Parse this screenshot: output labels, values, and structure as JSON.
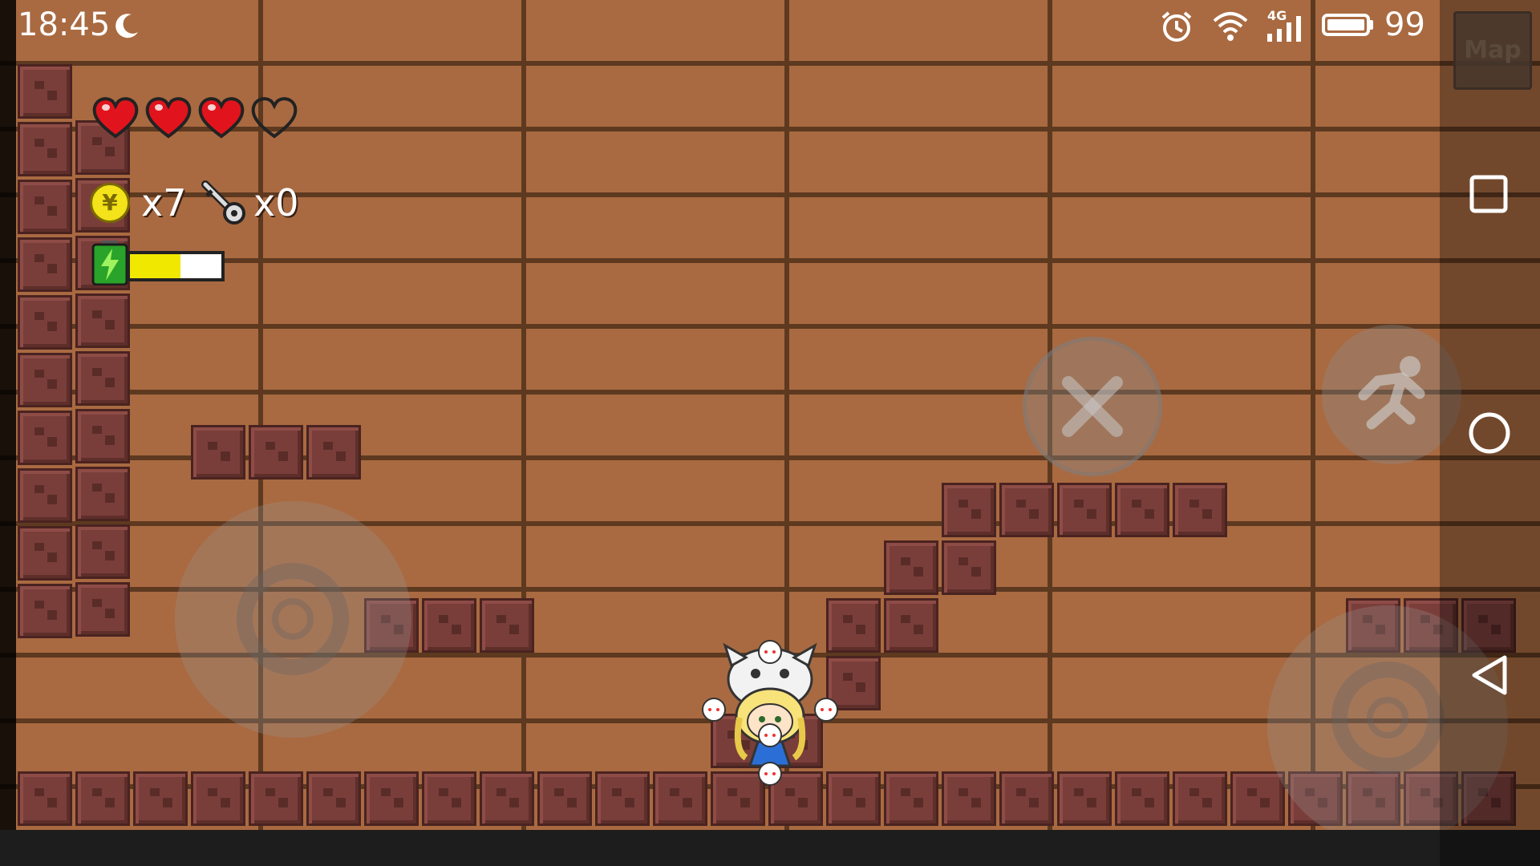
{
  "status_bar": {
    "time": "18:45",
    "moon_icon": "moon-icon",
    "alarm_icon": "alarm-icon",
    "wifi_icon": "wifi-icon",
    "network_label": "4G",
    "battery_level": "99"
  },
  "map_button": {
    "label": "Map"
  },
  "hud": {
    "hearts_filled": 3,
    "hearts_total": 4,
    "coin_symbol": "¥",
    "coins": "x7",
    "keys": "x0",
    "energy_fraction": 0.55
  },
  "controls": {
    "left_joystick": "move-joystick",
    "right_joystick": "aim-joystick",
    "cancel_button": "close-icon",
    "dash_button": "running-man-icon"
  },
  "nav_bar": {
    "recent": "square-icon",
    "home": "circle-icon",
    "back": "triangle-back-icon"
  },
  "colors": {
    "wall": "#a96a41",
    "plank_line": "#5d3920",
    "block": "#7a3e3a",
    "heart": "#e1141d",
    "coin": "#f4e21a",
    "energy": "#f1e800"
  }
}
